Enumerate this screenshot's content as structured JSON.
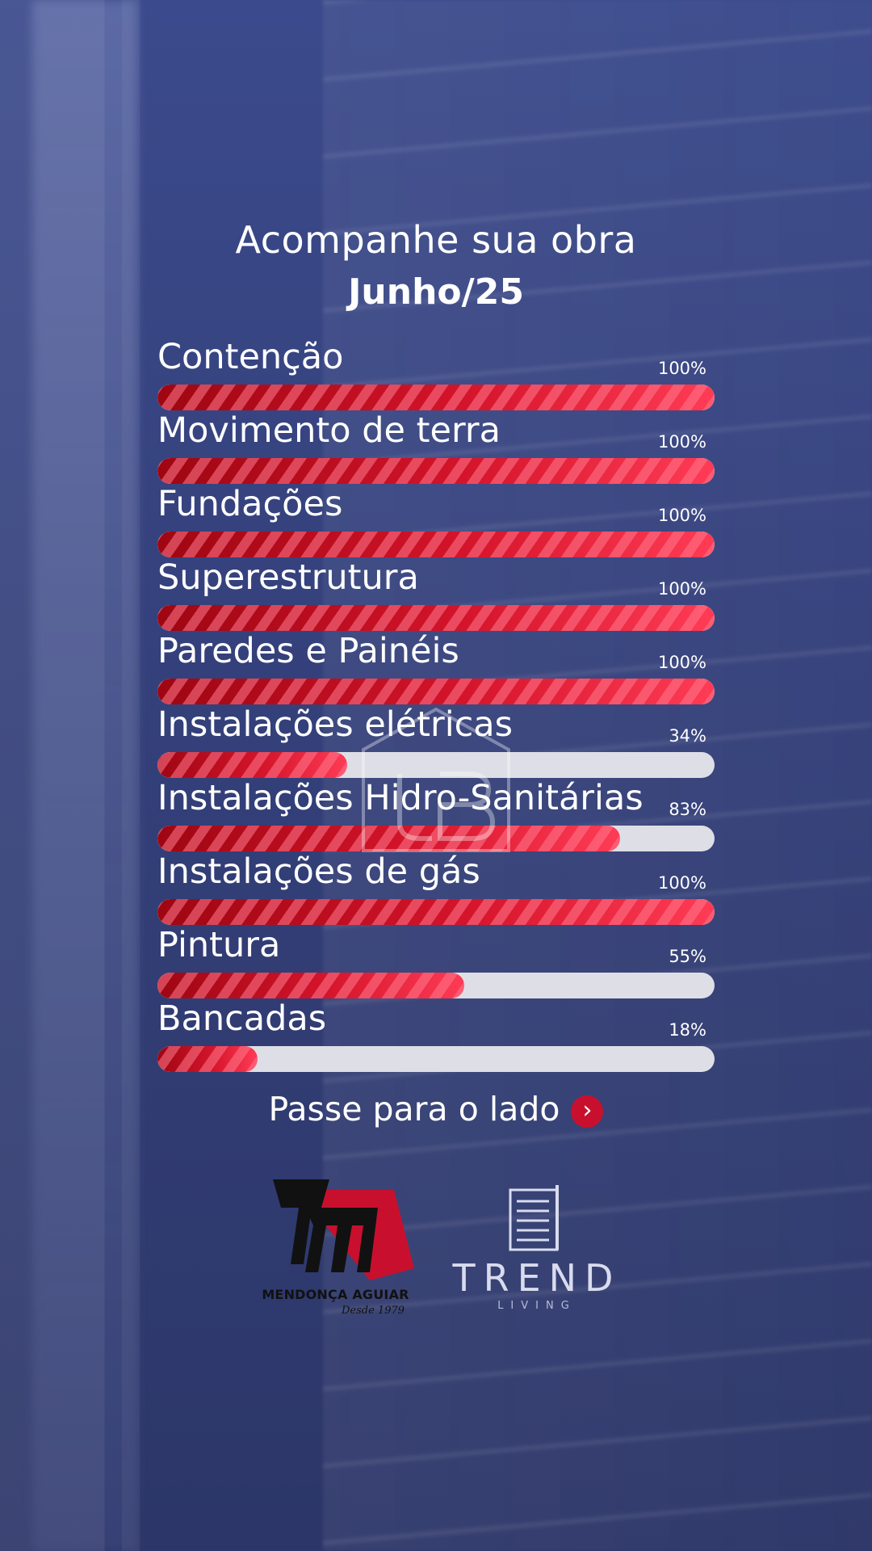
{
  "header": {
    "title": "Acompanhe sua obra",
    "subtitle": "Junho/25"
  },
  "progress_items": [
    {
      "label": "Contenção",
      "percent_text": "100%",
      "value": 100
    },
    {
      "label": "Movimento de terra",
      "percent_text": "100%",
      "value": 100
    },
    {
      "label": "Fundações",
      "percent_text": "100%",
      "value": 100
    },
    {
      "label": "Superestrutura",
      "percent_text": "100%",
      "value": 100
    },
    {
      "label": "Paredes e Painéis",
      "percent_text": "100%",
      "value": 100
    },
    {
      "label": "Instalações elétricas",
      "percent_text": "34%",
      "value": 34
    },
    {
      "label": "Instalações Hidro-Sanitárias",
      "percent_text": "83%",
      "value": 83
    },
    {
      "label": "Instalações de gás",
      "percent_text": "100%",
      "value": 100
    },
    {
      "label": "Pintura",
      "percent_text": "55%",
      "value": 55
    },
    {
      "label": "Bancadas",
      "percent_text": "18%",
      "value": 18
    }
  ],
  "swipe": {
    "text": "Passe para o lado",
    "icon": "chevron-right-circle-icon"
  },
  "logos": {
    "mendonca": {
      "name": "MENDONÇA AGUIAR",
      "since": "Desde 1979"
    },
    "trend": {
      "name": "TREND",
      "sub": "LIVING"
    }
  },
  "colors": {
    "bar_fill": "#d4142b",
    "bar_track": "#dedfe6",
    "background": "#34407a"
  }
}
